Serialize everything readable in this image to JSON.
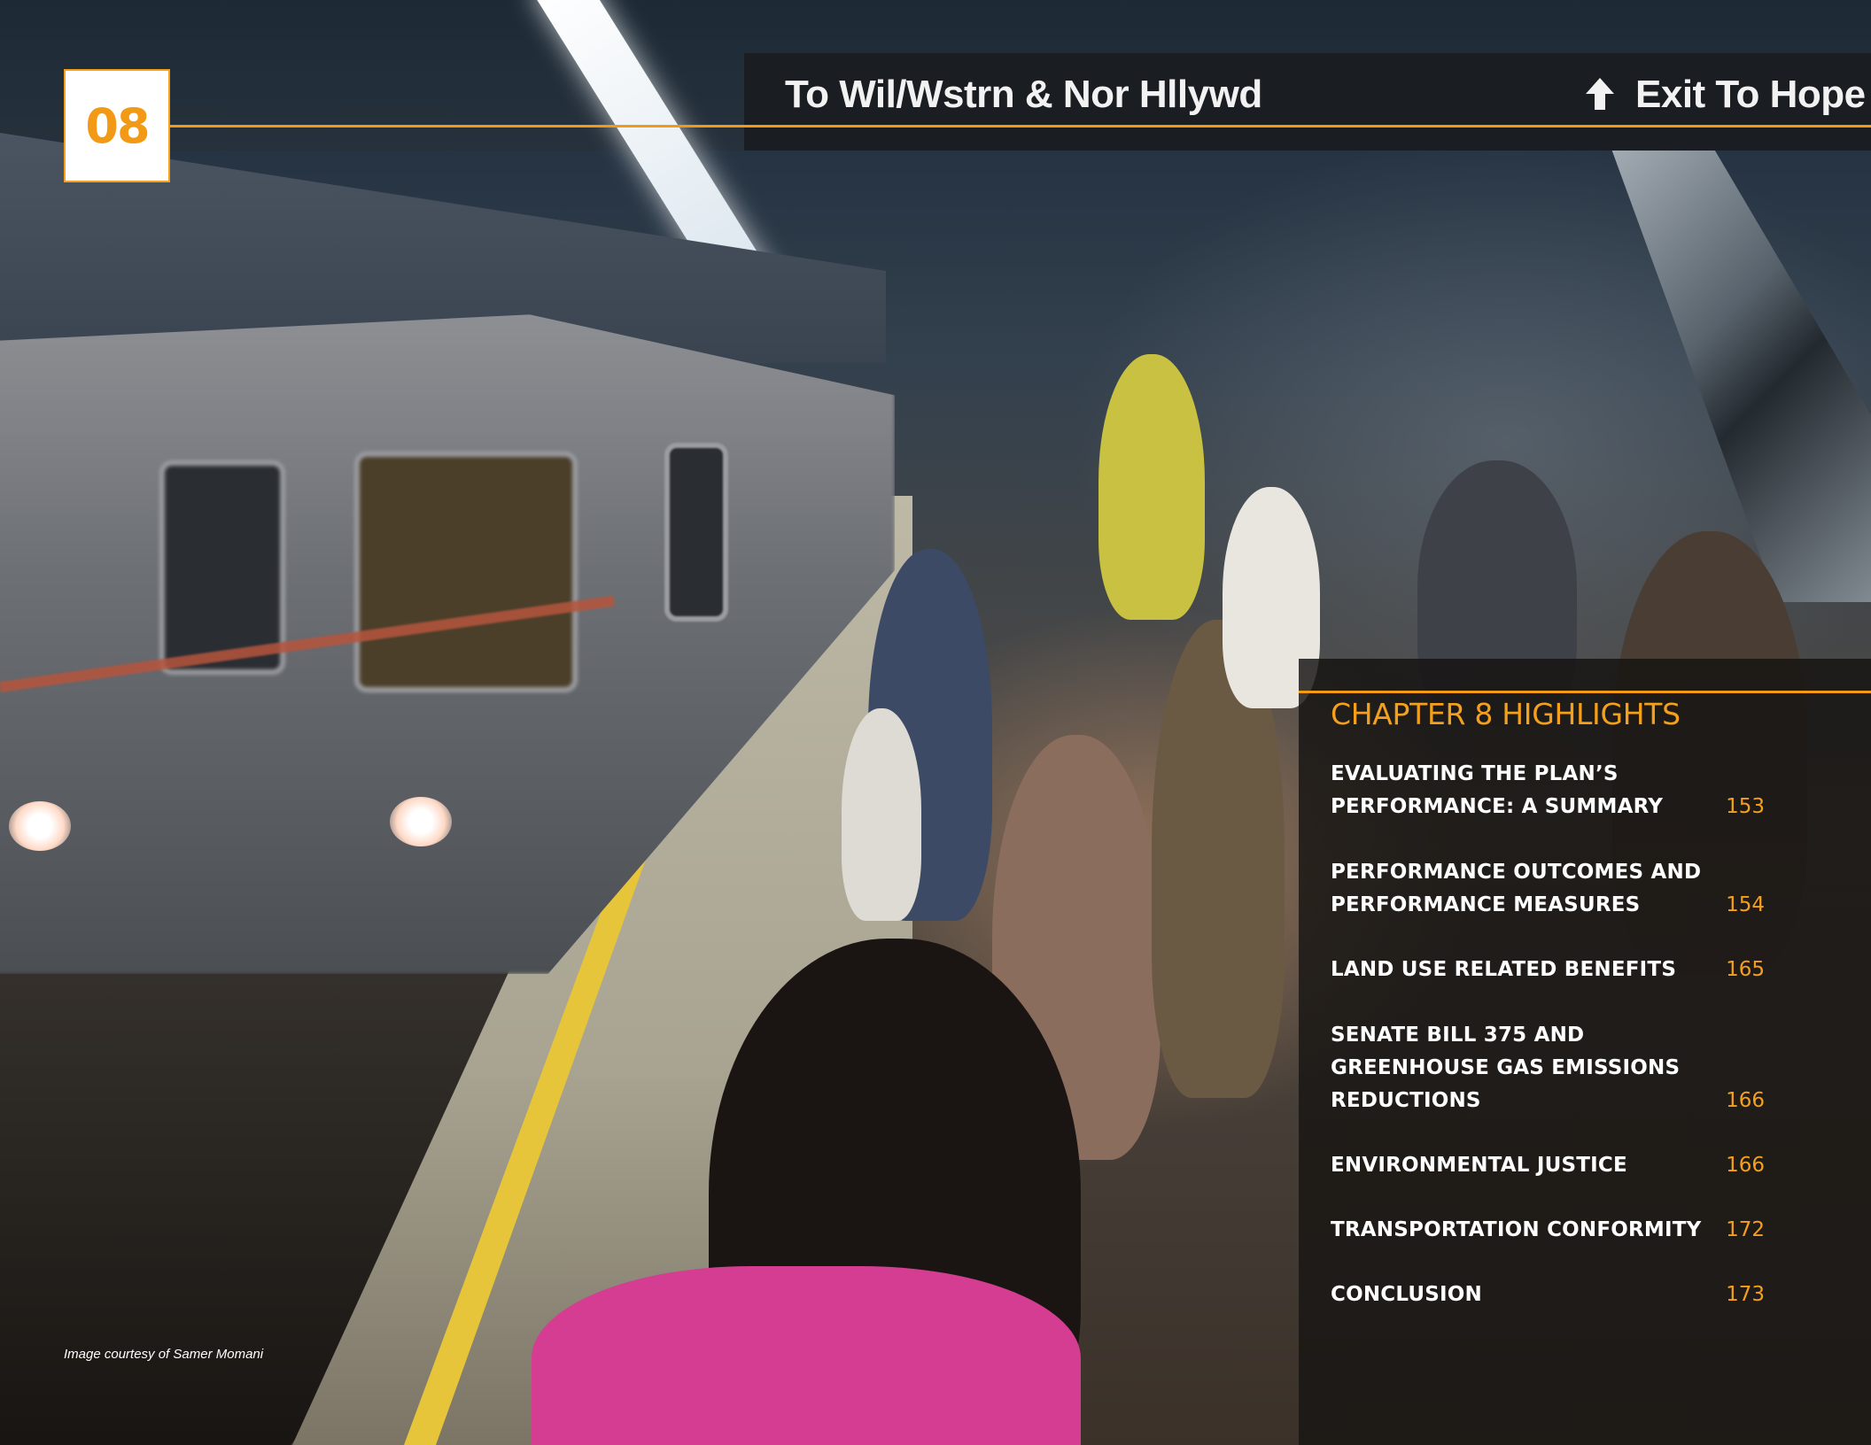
{
  "chapter": {
    "number": "08"
  },
  "signage": {
    "platform_sign": "To Wil/Wstrn & Nor Hllywd",
    "exit_sign": "Exit To Hope"
  },
  "photo_credit": "Image courtesy of Samer Momani",
  "highlights": {
    "title": "CHAPTER 8 HIGHLIGHTS",
    "items": [
      {
        "label": "EVALUATING THE PLAN’S\nPERFORMANCE: A SUMMARY",
        "page": "153"
      },
      {
        "label": "PERFORMANCE OUTCOMES AND\nPERFORMANCE MEASURES",
        "page": "154"
      },
      {
        "label": "LAND USE RELATED BENEFITS",
        "page": "165"
      },
      {
        "label": "SENATE BILL 375 AND\nGREENHOUSE GAS EMISSIONS\nREDUCTIONS",
        "page": "166"
      },
      {
        "label": "ENVIRONMENTAL JUSTICE",
        "page": "166"
      },
      {
        "label": "TRANSPORTATION CONFORMITY",
        "page": "172"
      },
      {
        "label": "CONCLUSION",
        "page": "173"
      }
    ]
  },
  "colors": {
    "accent": "#f29a16",
    "panel_bg": "#141210",
    "text": "#ffffff"
  }
}
